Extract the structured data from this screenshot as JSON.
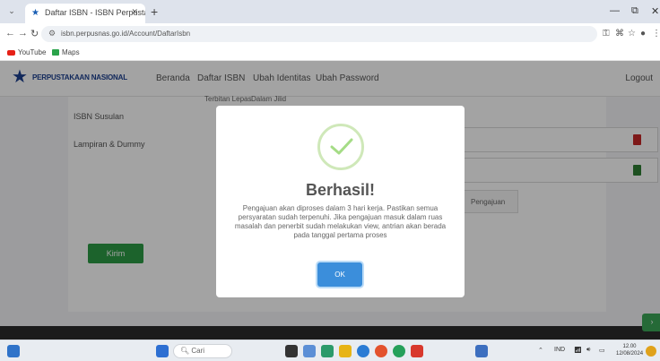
{
  "browser": {
    "tab_title": "Daftar ISBN - ISBN Perpustakaan",
    "address": "isbn.perpusnas.go.id/Account/DaftarIsbn",
    "bookmarks": [
      "YouTube",
      "Maps"
    ]
  },
  "site": {
    "logo_text": "PERPUSTAKAAN NASIONAL",
    "nav": [
      "Beranda",
      "Daftar ISBN",
      "Ubah Identitas",
      "Ubah Password"
    ],
    "logout": "Logout"
  },
  "form": {
    "labels": [
      "ISBN Susulan",
      "Lampiran & Dummy"
    ],
    "radio_row": [
      "Terbitan Lepas",
      "Dalam Jilid"
    ],
    "attachment_button": "Pengajuan",
    "submit_label": "Kirim"
  },
  "modal": {
    "title": "Berhasil!",
    "message": "Pengajuan akan diproses dalam 3 hari kerja. Pastikan semua persyaratan sudah terpenuhi. Jika pengajuan masuk dalam ruas masalah dan penerbit sudah melakukan view, antrian akan berada pada tanggal pertama proses",
    "ok_label": "OK",
    "success_color": "#a5dc86"
  },
  "taskbar": {
    "search_placeholder": "Cari",
    "language": "IND",
    "time": "12.00",
    "date": "12/08/2024"
  }
}
